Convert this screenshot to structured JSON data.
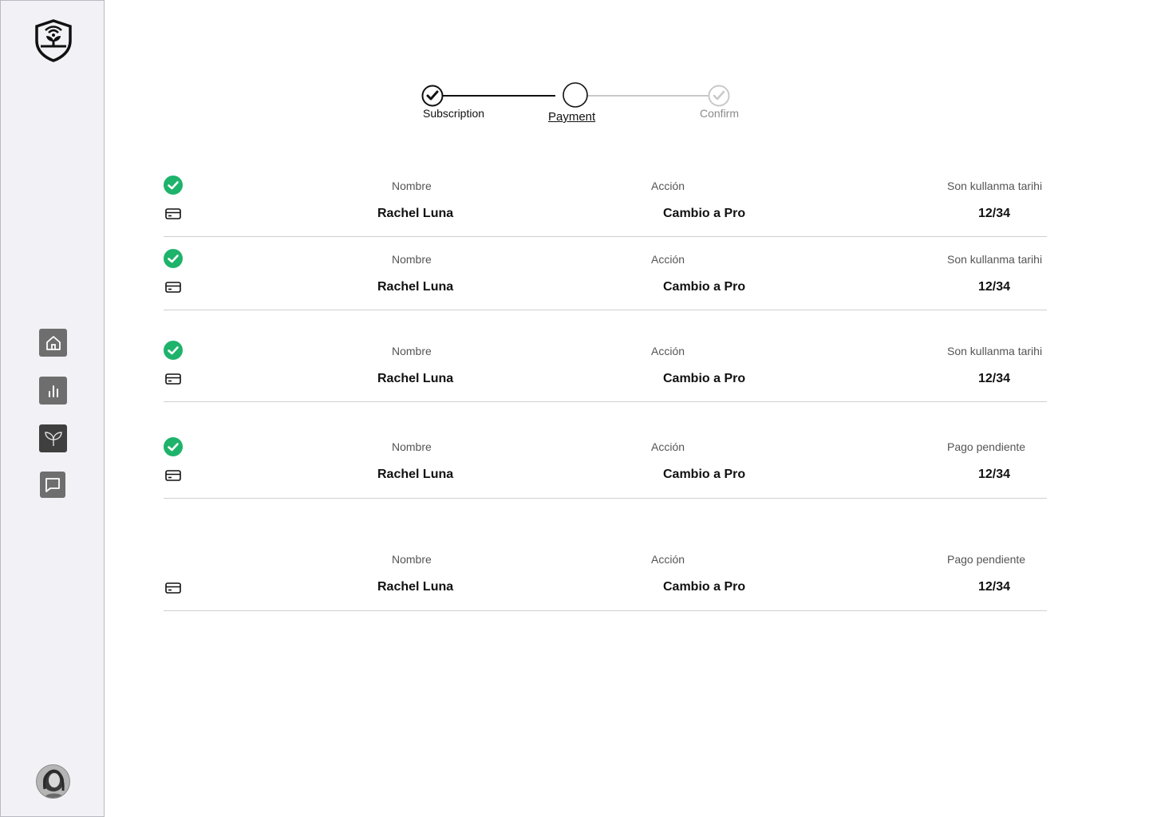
{
  "sidebar": {
    "logo_icon": "shield-plant-wifi-icon",
    "nav": [
      {
        "id": "home",
        "icon": "home-icon"
      },
      {
        "id": "stats",
        "icon": "bar-chart-icon"
      },
      {
        "id": "plants",
        "icon": "sprout-icon"
      },
      {
        "id": "chat",
        "icon": "chat-icon"
      }
    ],
    "avatar_icon": "user-avatar"
  },
  "stepper": {
    "steps": [
      {
        "label": "Subscription",
        "state": "completed"
      },
      {
        "label": "Payment",
        "state": "current"
      },
      {
        "label": "Confirm",
        "state": "upcoming"
      }
    ]
  },
  "colors": {
    "success": "#1eb36b",
    "sidebar_bg": "#f2f1f6"
  },
  "rows": [
    {
      "status": "check",
      "h1": "Nombre",
      "v1": "Rachel Luna",
      "h2": "Acción",
      "v2": "Cambio a Pro",
      "h3": "Son kullanma tarihi",
      "v3": "12/34"
    },
    {
      "status": "check",
      "h1": "Nombre",
      "v1": "Rachel Luna",
      "h2": "Acción",
      "v2": "Cambio a Pro",
      "h3": "Son kullanma tarihi",
      "v3": "12/34"
    },
    {
      "status": "check",
      "h1": "Nombre",
      "v1": "Rachel Luna",
      "h2": "Acción",
      "v2": "Cambio a Pro",
      "h3": "Son kullanma tarihi",
      "v3": "12/34"
    },
    {
      "status": "check",
      "h1": "Nombre",
      "v1": "Rachel Luna",
      "h2": "Acción",
      "v2": "Cambio a Pro",
      "h3": "Pago pendiente",
      "v3": "12/34"
    },
    {
      "status": "none",
      "h1": "Nombre",
      "v1": "Rachel Luna",
      "h2": "Acción",
      "v2": "Cambio a Pro",
      "h3": "Pago pendiente",
      "v3": "12/34"
    }
  ]
}
